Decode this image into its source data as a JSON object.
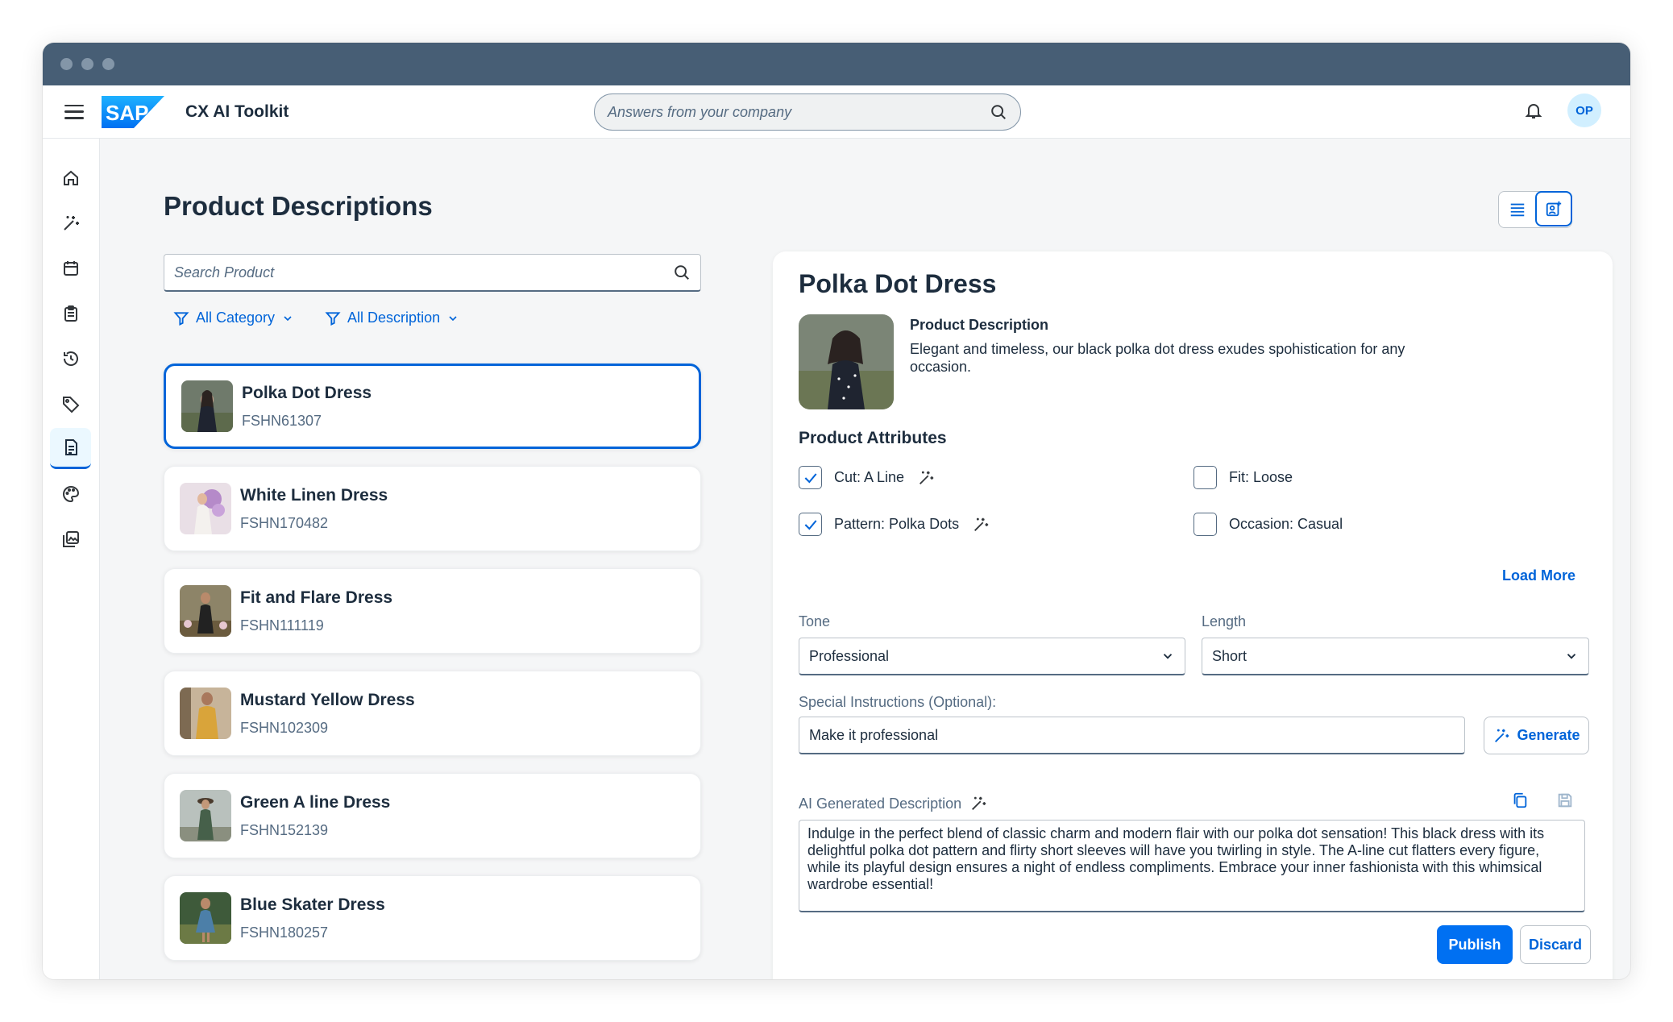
{
  "shell": {
    "logo_text": "SAP",
    "product_name": "CX AI Toolkit",
    "search_placeholder": "Answers from your company",
    "avatar_initials": "OP"
  },
  "sidenav": {
    "items": [
      {
        "icon": "home-icon",
        "active": false
      },
      {
        "icon": "ai-sparkle-icon",
        "active": false
      },
      {
        "icon": "calendar-icon",
        "active": false
      },
      {
        "icon": "clipboard-icon",
        "active": false
      },
      {
        "icon": "history-icon",
        "active": false
      },
      {
        "icon": "tag-icon",
        "active": false
      },
      {
        "icon": "document-icon",
        "active": true
      },
      {
        "icon": "palette-icon",
        "active": false
      },
      {
        "icon": "image-gallery-icon",
        "active": false
      }
    ]
  },
  "page": {
    "title": "Product Descriptions",
    "search_placeholder": "Search Product",
    "filters": {
      "category": "All Category",
      "description": "All Description"
    }
  },
  "products": [
    {
      "name": "Polka Dot Dress",
      "sku": "FSHN61307",
      "selected": true
    },
    {
      "name": "White Linen Dress",
      "sku": "FSHN170482",
      "selected": false
    },
    {
      "name": "Fit and Flare Dress",
      "sku": "FSHN111119",
      "selected": false
    },
    {
      "name": "Mustard Yellow Dress",
      "sku": "FSHN102309",
      "selected": false
    },
    {
      "name": "Green A line Dress",
      "sku": "FSHN152139",
      "selected": false
    },
    {
      "name": "Blue Skater Dress",
      "sku": "FSHN180257",
      "selected": false
    }
  ],
  "detail": {
    "title": "Polka Dot Dress",
    "description_label": "Product Description",
    "description_text": "Elegant and timeless, our black polka dot dress exudes spohistication for any occasion.",
    "attributes_title": "Product Attributes",
    "attributes": {
      "cut": {
        "label": "Cut: A Line",
        "checked": true
      },
      "fit": {
        "label": "Fit: Loose",
        "checked": false
      },
      "pattern": {
        "label": "Pattern: Polka Dots",
        "checked": true
      },
      "occasion": {
        "label": "Occasion: Casual",
        "checked": false
      }
    },
    "load_more": "Load More",
    "tone_label": "Tone",
    "tone_value": "Professional",
    "length_label": "Length",
    "length_value": "Short",
    "special_label": "Special Instructions (Optional):",
    "special_value": "Make it professional",
    "generate_label": "Generate",
    "ai_label": "AI Generated Description",
    "ai_text": "Indulge in the perfect blend of classic charm and modern flair with our polka dot sensation! This black dress with its delightful polka dot pattern and flirty short sleeves will have you twirling in style. The A-line cut flatters every figure, while its playful design ensures a night of endless compliments. Embrace your inner fashionista with this whimsical wardrobe essential!",
    "publish_label": "Publish",
    "discard_label": "Discard"
  },
  "colors": {
    "accent": "#0064d9",
    "titlebar": "#475e75",
    "button_primary": "#0070f2"
  }
}
